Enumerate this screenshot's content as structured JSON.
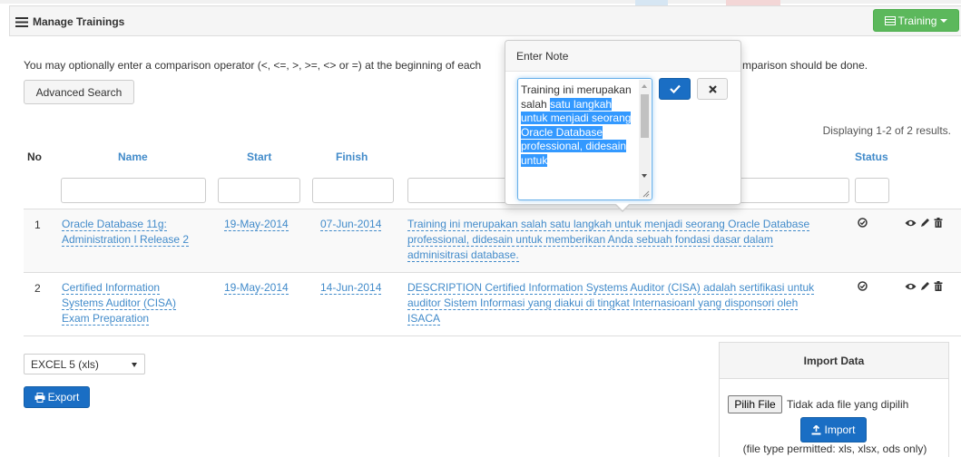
{
  "panel": {
    "title": "Manage Trainings",
    "menu_button": "Training"
  },
  "help": {
    "left": "You may optionally enter a comparison operator (<, <=, >, >=, <> or =) at the beginning of each",
    "right": "mparison should be done."
  },
  "advanced_search_label": "Advanced Search",
  "summary": "Displaying 1-2 of 2 results.",
  "columns": {
    "no": "No",
    "name": "Name",
    "start": "Start",
    "finish": "Finish",
    "status": "Status"
  },
  "rows": [
    {
      "no": "1",
      "name_line1": "Oracle Database 11g:",
      "name_line2": "Administration I Release 2",
      "name_line3": "",
      "start": "19-May-2014",
      "finish": "07-Jun-2014",
      "desc_line1": "Training ini merupakan salah satu langkah untuk menjadi seorang Oracle Database",
      "desc_line2": "professional, didesain untuk memberikan Anda sebuah fondasi dasar dalam",
      "desc_line3": "adminisitrasi database."
    },
    {
      "no": "2",
      "name_line1": "Certified Information",
      "name_line2": "Systems Auditor (CISA)",
      "name_line3": "Exam Preparation",
      "start": "19-May-2014",
      "finish": "14-Jun-2014",
      "desc_line1": "DESCRIPTION Certified Information Systems Auditor (CISA) adalah sertifikasi untuk",
      "desc_line2": "auditor Sistem Informasi yang diakui di tingkat Internasioanl yang disponsori oleh",
      "desc_line3": "ISACA"
    }
  ],
  "export": {
    "format": "EXCEL 5 (xls)",
    "button": "Export"
  },
  "import": {
    "title": "Import Data",
    "file_button": "Pilih File",
    "file_status": "Tidak ada file yang dipilih",
    "button": "Import",
    "note": "(file type permitted: xls, xlsx, ods only)"
  },
  "popover": {
    "title": "Enter Note",
    "note_plain": "Training ini merupakan salah",
    "note_selected": "satu langkah untuk menjadi seorang Oracle Database professional, didesain untuk"
  },
  "colors": {
    "link": "#428bca",
    "primary": "#1a6ec4",
    "success": "#5cb85c",
    "selection": "#3399ff"
  },
  "icons": [
    "list-icon",
    "table-icon",
    "check-circle-icon",
    "eye-icon",
    "pencil-icon",
    "trash-icon",
    "print-icon",
    "upload-icon",
    "checkmark-icon",
    "close-icon"
  ]
}
